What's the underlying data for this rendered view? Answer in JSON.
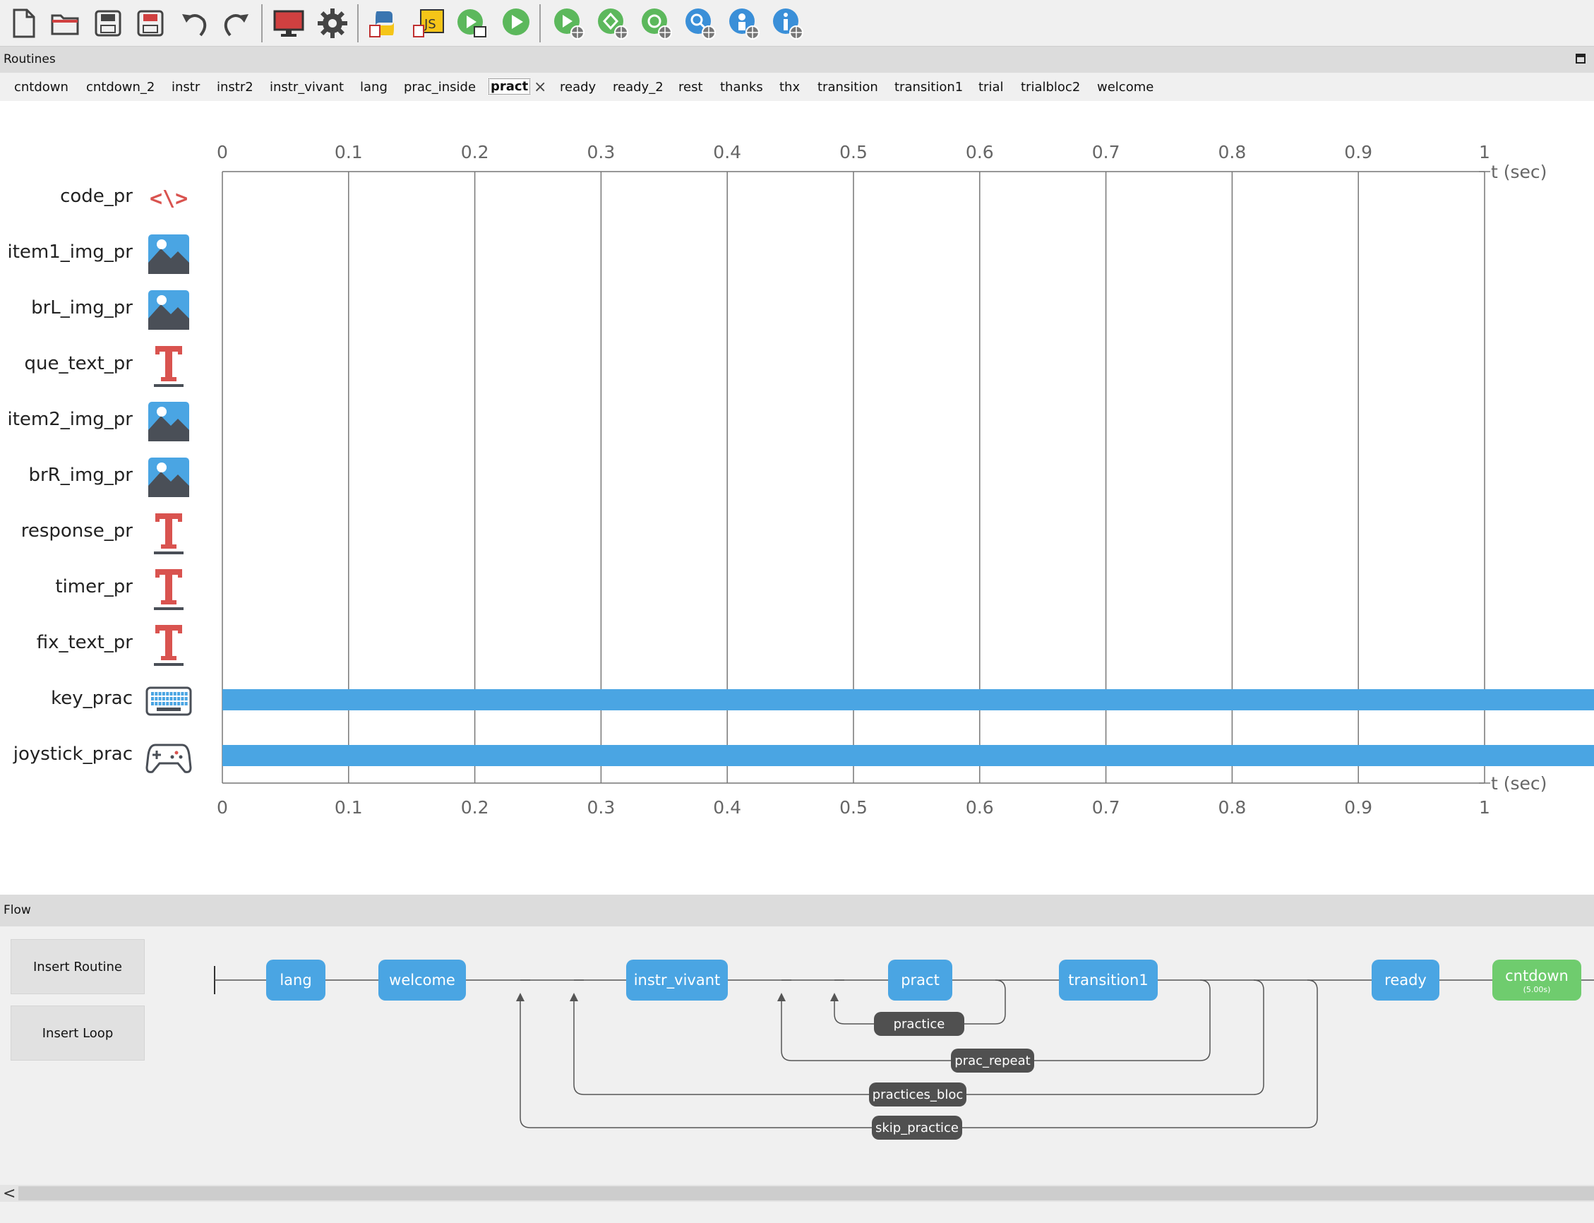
{
  "toolbar": {
    "buttons": [
      {
        "name": "new-file-icon"
      },
      {
        "name": "open-folder-icon"
      },
      {
        "name": "save-icon"
      },
      {
        "name": "save-as-icon"
      },
      {
        "name": "undo-icon"
      },
      {
        "name": "redo-icon"
      },
      {
        "name": "monitor-settings-icon"
      },
      {
        "name": "experiment-settings-gear-icon"
      },
      {
        "name": "compile-python-icon"
      },
      {
        "name": "compile-js-icon"
      },
      {
        "name": "run-script-icon"
      },
      {
        "name": "run-experiment-icon"
      },
      {
        "name": "pilot-online-icon"
      },
      {
        "name": "sync-online-icon"
      },
      {
        "name": "project-online-icon"
      },
      {
        "name": "search-online-icon"
      },
      {
        "name": "user-online-icon"
      },
      {
        "name": "info-online-icon"
      }
    ]
  },
  "routines_panel": {
    "title": "Routines",
    "tabs": [
      "cntdown",
      "cntdown_2",
      "instr",
      "instr2",
      "instr_vivant",
      "lang",
      "prac_inside",
      "pract",
      "ready",
      "ready_2",
      "rest",
      "thanks",
      "thx",
      "transition",
      "transition1",
      "trial",
      "trialbloc2",
      "welcome"
    ],
    "active_tab": "pract",
    "close_glyph": "×"
  },
  "timeline": {
    "ticks": [
      "0",
      "0.1",
      "0.2",
      "0.3",
      "0.4",
      "0.5",
      "0.6",
      "0.7",
      "0.8",
      "0.9",
      "1"
    ],
    "unit_label": "t (sec)",
    "components": [
      {
        "name": "code_pr",
        "icon": "code-icon",
        "bar": false
      },
      {
        "name": "item1_img_pr",
        "icon": "image-icon",
        "bar": false
      },
      {
        "name": "brL_img_pr",
        "icon": "image-icon",
        "bar": false
      },
      {
        "name": "que_text_pr",
        "icon": "text-icon",
        "bar": false
      },
      {
        "name": "item2_img_pr",
        "icon": "image-icon",
        "bar": false
      },
      {
        "name": "brR_img_pr",
        "icon": "image-icon",
        "bar": false
      },
      {
        "name": "response_pr",
        "icon": "text-icon",
        "bar": false
      },
      {
        "name": "timer_pr",
        "icon": "text-icon",
        "bar": false
      },
      {
        "name": "fix_text_pr",
        "icon": "text-icon",
        "bar": false
      },
      {
        "name": "key_prac",
        "icon": "keyboard-icon",
        "bar": true
      },
      {
        "name": "joystick_prac",
        "icon": "gamepad-icon",
        "bar": true
      }
    ],
    "bar_color": "#4aa5e3"
  },
  "flow_panel": {
    "title": "Flow",
    "insert_routine_label": "Insert Routine",
    "insert_loop_label": "Insert Loop",
    "routines": [
      {
        "label": "lang",
        "color": "#4aa5e3"
      },
      {
        "label": "welcome",
        "color": "#4aa5e3"
      },
      {
        "label": "instr_vivant",
        "color": "#4aa5e3"
      },
      {
        "label": "pract",
        "color": "#4aa5e3"
      },
      {
        "label": "transition1",
        "color": "#4aa5e3"
      },
      {
        "label": "ready",
        "color": "#4aa5e3"
      },
      {
        "label": "cntdown",
        "sub": "(5.00s)",
        "color": "#6fcc6e"
      }
    ],
    "loops": [
      "practice",
      "prac_repeat",
      "practices_bloc",
      "skip_practice"
    ]
  },
  "scrollbar": {
    "left_arrow": "<"
  }
}
